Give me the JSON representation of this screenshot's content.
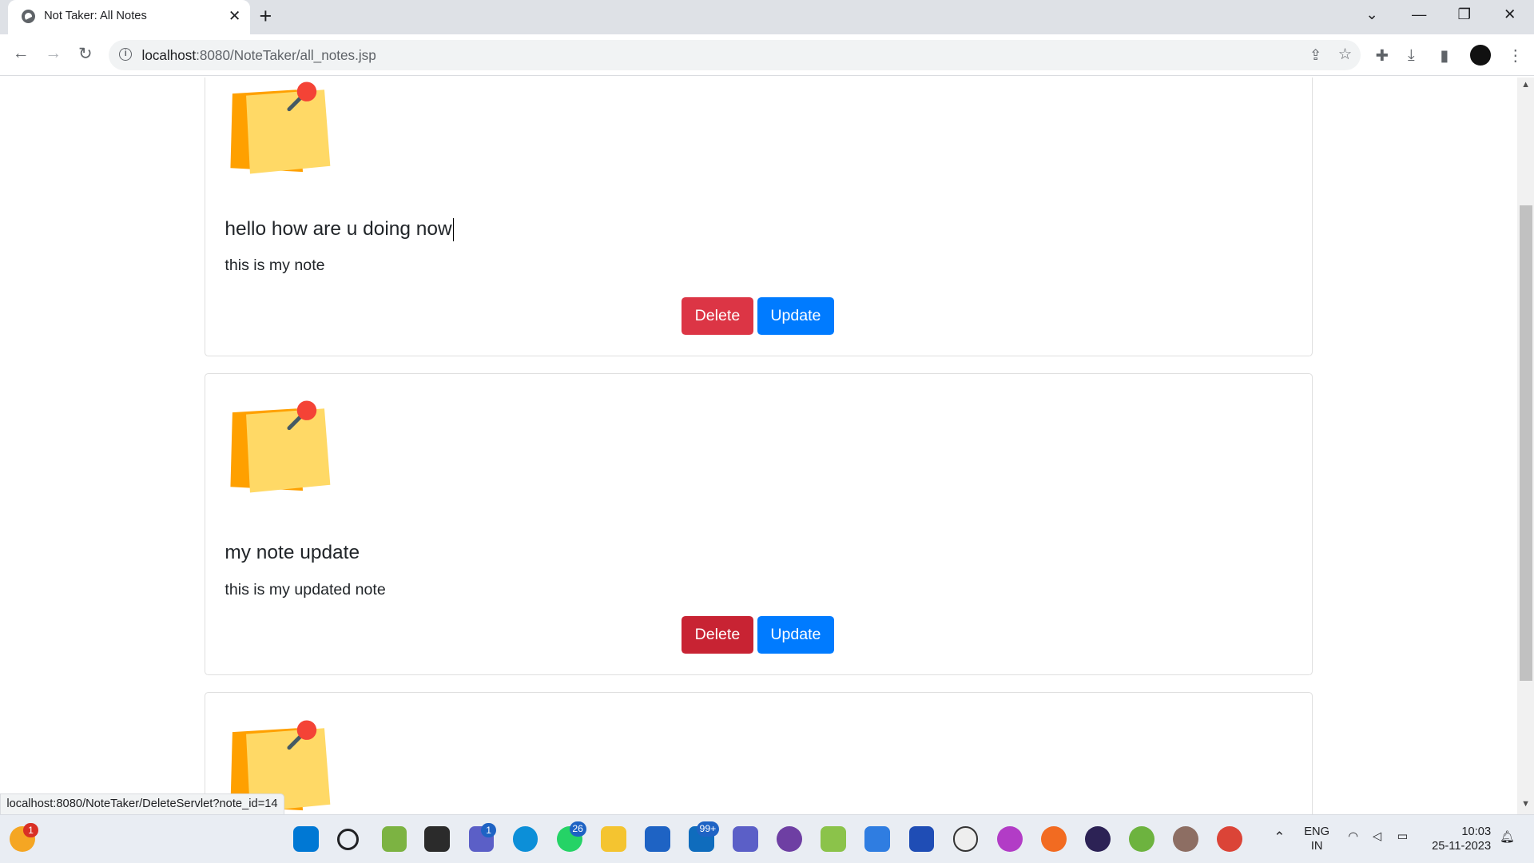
{
  "browser": {
    "tab_title": "Not Taker: All Notes",
    "tab_close": "✕",
    "new_tab": "+",
    "url_prefix": "localhost",
    "url_rest": ":8080/NoteTaker/all_notes.jsp"
  },
  "notes": [
    {
      "title": "hello how are u doing now",
      "body": "this is my note",
      "delete_label": "Delete",
      "update_label": "Update"
    },
    {
      "title": "my note update",
      "body": "this is my updated note",
      "delete_label": "Delete",
      "update_label": "Update"
    }
  ],
  "status_url": "localhost:8080/NoteTaker/DeleteServlet?note_id=14",
  "taskbar": {
    "badges": {
      "widgets": "1",
      "teams": "1",
      "whatsapp": "26",
      "mail": "99+"
    },
    "lang_top": "ENG",
    "lang_bottom": "IN",
    "time": "10:03",
    "date": "25-11-2023"
  },
  "colors": {
    "delete": "#dc3545",
    "update": "#007bff",
    "note_yellow": "#ffd966",
    "note_orange": "#ffa000",
    "pin": "#f44336"
  }
}
